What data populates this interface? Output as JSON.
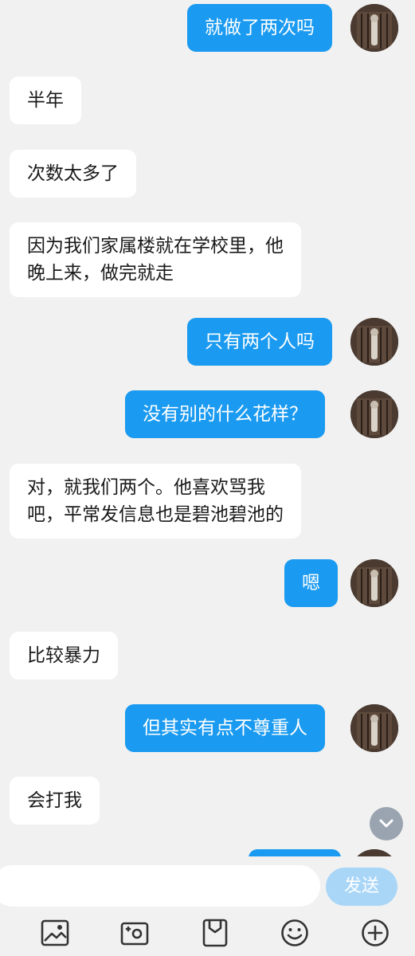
{
  "messages": [
    {
      "side": "out",
      "text": "就做了两次吗"
    },
    {
      "side": "in",
      "text": "半年"
    },
    {
      "side": "in",
      "text": "次数太多了"
    },
    {
      "side": "in",
      "text": "因为我们家属楼就在学校里，他\n晚上来，做完就走"
    },
    {
      "side": "out",
      "text": "只有两个人吗"
    },
    {
      "side": "out",
      "text": "没有别的什么花样？"
    },
    {
      "side": "in",
      "text": "对，就我们两个。他喜欢骂我\n吧，平常发信息也是碧池碧池的"
    },
    {
      "side": "out",
      "text": "嗯"
    },
    {
      "side": "in",
      "text": "比较暴力"
    },
    {
      "side": "out",
      "text": "但其实有点不尊重人"
    },
    {
      "side": "in",
      "text": "会打我"
    }
  ],
  "composer": {
    "input_value": "",
    "send_label": "发送"
  },
  "toolbar": {
    "icons": [
      "image-icon",
      "camera-icon",
      "file-icon",
      "emoji-icon",
      "plus-icon"
    ]
  },
  "colors": {
    "outgoing_bubble": "#1a9af0",
    "incoming_bubble": "#ffffff",
    "background": "#f1f1f1",
    "send_button": "#a9d6f7"
  }
}
